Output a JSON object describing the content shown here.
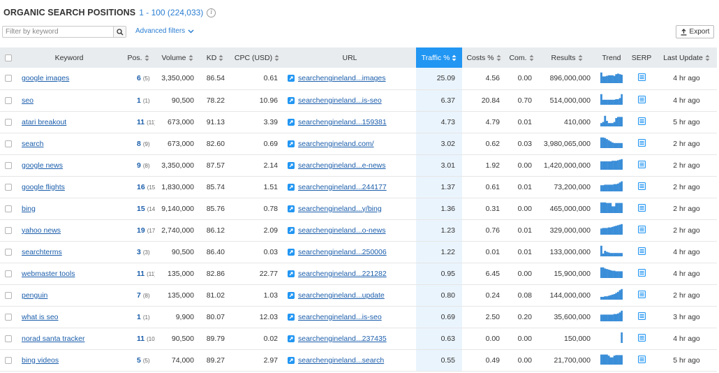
{
  "header": {
    "title": "ORGANIC SEARCH POSITIONS",
    "range": "1 - 100 (224,033)",
    "info": "i"
  },
  "filter": {
    "placeholder": "Filter by keyword",
    "advanced_label": "Advanced filters"
  },
  "export_label": "Export",
  "columns": {
    "keyword": "Keyword",
    "pos": "Pos.",
    "volume": "Volume",
    "kd": "KD",
    "cpc": "CPC (USD)",
    "url": "URL",
    "traffic": "Traffic %",
    "costs": "Costs %",
    "com": "Com.",
    "results": "Results",
    "trend": "Trend",
    "serp": "SERP",
    "last_update": "Last Update"
  },
  "colors": {
    "link": "#1a5dab",
    "accent": "#2196f3",
    "trend": "#3b8ed8",
    "traffic_bg": "#eaf4fd"
  },
  "rows": [
    {
      "keyword": "google images",
      "pos": "6",
      "prev": "(5)",
      "volume": "3,350,000",
      "kd": "86.54",
      "cpc": "0.61",
      "url": "searchengineland...images",
      "traffic": "25.09",
      "costs": "4.56",
      "com": "0.00",
      "results": "896,000,000",
      "trend": [
        0.95,
        0.6,
        0.6,
        0.65,
        0.7,
        0.7,
        0.7,
        0.65,
        0.8,
        0.85,
        0.8,
        0.75
      ],
      "updated": "4 hr ago"
    },
    {
      "keyword": "seo",
      "pos": "1",
      "prev": "(1)",
      "volume": "90,500",
      "kd": "78.22",
      "cpc": "10.96",
      "url": "searchengineland...is-seo",
      "traffic": "6.37",
      "costs": "20.84",
      "com": "0.70",
      "results": "514,000,000",
      "trend": [
        0.95,
        0.45,
        0.45,
        0.45,
        0.45,
        0.45,
        0.45,
        0.45,
        0.5,
        0.5,
        0.6,
        0.95
      ],
      "updated": "4 hr ago"
    },
    {
      "keyword": "atari breakout",
      "pos": "11",
      "prev": "(11)",
      "volume": "673,000",
      "kd": "91.13",
      "cpc": "3.39",
      "url": "searchengineland...159381",
      "traffic": "4.73",
      "costs": "4.79",
      "com": "0.01",
      "results": "410,000",
      "trend": [
        0.3,
        0.4,
        0.95,
        0.5,
        0.3,
        0.3,
        0.3,
        0.4,
        0.75,
        0.85,
        0.85,
        0.85
      ],
      "updated": "5 hr ago"
    },
    {
      "keyword": "search",
      "pos": "8",
      "prev": "(9)",
      "volume": "673,000",
      "kd": "82.60",
      "cpc": "0.69",
      "url": "searchengineland.com/",
      "traffic": "3.02",
      "costs": "0.62",
      "com": "0.03",
      "results": "3,980,065,000",
      "trend": [
        0.95,
        0.95,
        0.9,
        0.8,
        0.7,
        0.6,
        0.5,
        0.45,
        0.45,
        0.45,
        0.45,
        0.45
      ],
      "updated": "2 hr ago"
    },
    {
      "keyword": "google news",
      "pos": "9",
      "prev": "(8)",
      "volume": "3,350,000",
      "kd": "87.57",
      "cpc": "2.14",
      "url": "searchengineland...e-news",
      "traffic": "3.01",
      "costs": "1.92",
      "com": "0.00",
      "results": "1,420,000,000",
      "trend": [
        0.75,
        0.75,
        0.75,
        0.75,
        0.75,
        0.75,
        0.8,
        0.8,
        0.8,
        0.85,
        0.9,
        0.95
      ],
      "updated": "2 hr ago"
    },
    {
      "keyword": "google flights",
      "pos": "16",
      "prev": "(15)",
      "volume": "1,830,000",
      "kd": "85.74",
      "cpc": "1.51",
      "url": "searchengineland...244177",
      "traffic": "1.37",
      "costs": "0.61",
      "com": "0.01",
      "results": "73,200,000",
      "trend": [
        0.55,
        0.55,
        0.6,
        0.6,
        0.6,
        0.6,
        0.6,
        0.65,
        0.65,
        0.7,
        0.8,
        0.9
      ],
      "updated": "2 hr ago"
    },
    {
      "keyword": "bing",
      "pos": "15",
      "prev": "(14)",
      "volume": "9,140,000",
      "kd": "85.76",
      "cpc": "0.78",
      "url": "searchengineland...y/bing",
      "traffic": "1.36",
      "costs": "0.31",
      "com": "0.00",
      "results": "465,000,000",
      "trend": [
        0.95,
        0.95,
        0.95,
        0.9,
        0.9,
        0.9,
        0.6,
        0.6,
        0.9,
        0.9,
        0.9,
        0.9
      ],
      "updated": "2 hr ago"
    },
    {
      "keyword": "yahoo news",
      "pos": "19",
      "prev": "(17)",
      "volume": "2,740,000",
      "kd": "86.12",
      "cpc": "2.09",
      "url": "searchengineland...o-news",
      "traffic": "1.23",
      "costs": "0.76",
      "com": "0.01",
      "results": "329,000,000",
      "trend": [
        0.55,
        0.6,
        0.6,
        0.6,
        0.65,
        0.65,
        0.7,
        0.75,
        0.8,
        0.85,
        0.9,
        0.95
      ],
      "updated": "2 hr ago"
    },
    {
      "keyword": "searchterms",
      "pos": "3",
      "prev": "(3)",
      "volume": "90,500",
      "kd": "86.40",
      "cpc": "0.03",
      "url": "searchengineland...250006",
      "traffic": "1.22",
      "costs": "0.01",
      "com": "0.01",
      "results": "133,000,000",
      "trend": [
        0.95,
        0.25,
        0.5,
        0.4,
        0.35,
        0.3,
        0.3,
        0.3,
        0.3,
        0.3,
        0.3,
        0.3
      ],
      "updated": "4 hr ago"
    },
    {
      "keyword": "webmaster tools",
      "pos": "11",
      "prev": "(11)",
      "volume": "135,000",
      "kd": "82.86",
      "cpc": "22.77",
      "url": "searchengineland...221282",
      "traffic": "0.95",
      "costs": "6.45",
      "com": "0.00",
      "results": "15,900,000",
      "trend": [
        0.95,
        0.95,
        0.85,
        0.8,
        0.75,
        0.7,
        0.65,
        0.65,
        0.6,
        0.6,
        0.6,
        0.6
      ],
      "updated": "4 hr ago"
    },
    {
      "keyword": "penguin",
      "pos": "7",
      "prev": "(8)",
      "volume": "135,000",
      "kd": "81.02",
      "cpc": "1.03",
      "url": "searchengineland...update",
      "traffic": "0.80",
      "costs": "0.24",
      "com": "0.08",
      "results": "144,000,000",
      "trend": [
        0.25,
        0.25,
        0.3,
        0.3,
        0.35,
        0.4,
        0.45,
        0.5,
        0.6,
        0.7,
        0.85,
        0.95
      ],
      "updated": "2 hr ago"
    },
    {
      "keyword": "what is seo",
      "pos": "1",
      "prev": "(1)",
      "volume": "9,900",
      "kd": "80.07",
      "cpc": "12.03",
      "url": "searchengineland...is-seo",
      "traffic": "0.69",
      "costs": "2.50",
      "com": "0.20",
      "results": "35,600,000",
      "trend": [
        0.6,
        0.6,
        0.6,
        0.6,
        0.6,
        0.6,
        0.6,
        0.65,
        0.65,
        0.7,
        0.8,
        0.95
      ],
      "updated": "3 hr ago"
    },
    {
      "keyword": "norad santa tracker",
      "pos": "11",
      "prev": "(10)",
      "volume": "90,500",
      "kd": "89.79",
      "cpc": "0.02",
      "url": "searchengineland...237435",
      "traffic": "0.63",
      "costs": "0.00",
      "com": "0.00",
      "results": "150,000",
      "trend": [
        0,
        0,
        0,
        0,
        0,
        0,
        0,
        0,
        0,
        0,
        0,
        0.95
      ],
      "updated": "4 hr ago"
    },
    {
      "keyword": "bing videos",
      "pos": "5",
      "prev": "(5)",
      "volume": "74,000",
      "kd": "89.27",
      "cpc": "2.97",
      "url": "searchengineland...search",
      "traffic": "0.55",
      "costs": "0.49",
      "com": "0.00",
      "results": "21,700,000",
      "trend": [
        0.9,
        0.9,
        0.9,
        0.9,
        0.8,
        0.65,
        0.65,
        0.8,
        0.85,
        0.85,
        0.85,
        0.85
      ],
      "updated": "5 hr ago"
    }
  ]
}
